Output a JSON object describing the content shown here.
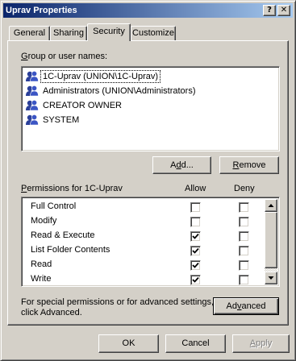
{
  "window": {
    "title": "Uprav Properties",
    "help_glyph": "?",
    "close_glyph": "✕"
  },
  "tabs": [
    {
      "label": "General",
      "active": false
    },
    {
      "label": "Sharing",
      "active": false
    },
    {
      "label": "Security",
      "active": true
    },
    {
      "label": "Customize",
      "active": false
    }
  ],
  "group_section": {
    "label_prefix": "",
    "label_underlined": "G",
    "label_rest": "roup or user names:",
    "users": [
      {
        "name": "1C-Uprav (UNION\\1C-Uprav)",
        "icon": "group-icon",
        "selected": true
      },
      {
        "name": "Administrators (UNION\\Administrators)",
        "icon": "group-icon",
        "selected": false
      },
      {
        "name": "CREATOR OWNER",
        "icon": "group-icon",
        "selected": false
      },
      {
        "name": "SYSTEM",
        "icon": "group-icon",
        "selected": false
      }
    ]
  },
  "buttons": {
    "add_pre": "A",
    "add_u": "d",
    "add_post": "d...",
    "remove_pre": "",
    "remove_u": "R",
    "remove_post": "emove",
    "advanced_pre": "Ad",
    "advanced_u": "v",
    "advanced_post": "anced",
    "ok": "OK",
    "cancel": "Cancel",
    "apply_pre": "",
    "apply_u": "A",
    "apply_post": "pply"
  },
  "permissions": {
    "label_pre": "",
    "label_u": "P",
    "label_rest": "ermissions for 1C-Uprav",
    "allow_header": "Allow",
    "deny_header": "Deny",
    "rows": [
      {
        "name": "Full Control",
        "allow": false,
        "deny": false
      },
      {
        "name": "Modify",
        "allow": false,
        "deny": false
      },
      {
        "name": "Read & Execute",
        "allow": true,
        "deny": false
      },
      {
        "name": "List Folder Contents",
        "allow": true,
        "deny": false
      },
      {
        "name": "Read",
        "allow": true,
        "deny": false
      },
      {
        "name": "Write",
        "allow": true,
        "deny": false
      }
    ]
  },
  "special_note": {
    "line1": "For special permissions or for advanced settings,",
    "line2": "click Advanced."
  }
}
